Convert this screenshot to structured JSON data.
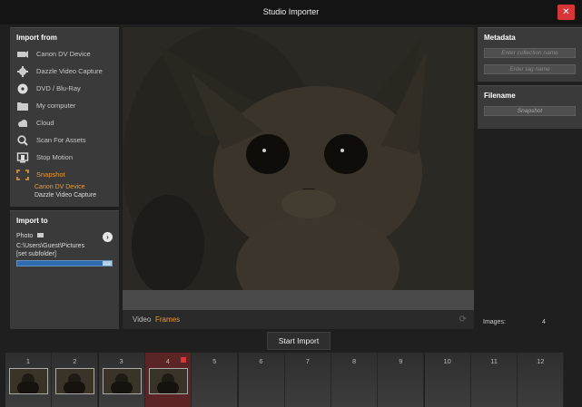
{
  "window": {
    "title": "Studio Importer",
    "close_glyph": "✕"
  },
  "import_from": {
    "heading": "Import from",
    "sources": [
      {
        "label": "Canon DV Device",
        "icon": "camcorder-icon"
      },
      {
        "label": "Dazzle Video Capture",
        "icon": "capture-card-icon"
      },
      {
        "label": "DVD / Blu-Ray",
        "icon": "disc-icon"
      },
      {
        "label": "My computer",
        "icon": "folder-icon"
      },
      {
        "label": "Cloud",
        "icon": "cloud-icon"
      },
      {
        "label": "Scan For Assets",
        "icon": "magnifier-icon"
      },
      {
        "label": "Stop Motion",
        "icon": "stop-motion-icon"
      },
      {
        "label": "Snapshot",
        "icon": "snapshot-icon",
        "active": true
      }
    ],
    "snapshot_devices": [
      "Canon DV Device",
      "Dazzle Video Capture"
    ]
  },
  "import_to": {
    "heading": "Import to",
    "type_label": "Photo",
    "path": "C:\\Users\\Guest\\Pictures",
    "subfolder": "[set subfolder]",
    "space_used": 0.9,
    "space_label": "....."
  },
  "preview": {
    "mode_tabs": [
      "Video",
      "Frames"
    ],
    "active_mode": "Frames"
  },
  "metadata": {
    "heading": "Metadata",
    "collection_placeholder": "Enter collection name",
    "tag_placeholder": "Enter tag name"
  },
  "filename": {
    "heading": "Filename",
    "value": "Snapshot"
  },
  "images": {
    "label": "Images:",
    "count": "4"
  },
  "start_button": "Start Import",
  "thumbnails": {
    "numbers": [
      "1",
      "2",
      "3",
      "4",
      "5",
      "6",
      "7",
      "8",
      "9",
      "10",
      "11",
      "12"
    ],
    "filled": 4,
    "selected": 4
  },
  "colors": {
    "accent": "#e89b3c",
    "close": "#d63637",
    "progress": "#2d6cb3"
  }
}
